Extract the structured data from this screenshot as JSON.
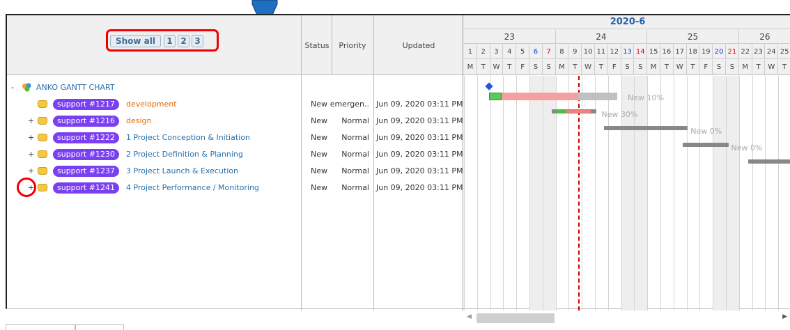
{
  "pager": {
    "show_all": "Show all",
    "pages": [
      "1",
      "2",
      "3"
    ]
  },
  "columns": {
    "status": "Status",
    "priority": "Priority",
    "updated": "Updated"
  },
  "timeline": {
    "month": "2020-6",
    "weeks": [
      "23",
      "24",
      "25",
      "26"
    ],
    "days": [
      "1",
      "2",
      "3",
      "4",
      "5",
      "6",
      "7",
      "8",
      "9",
      "10",
      "11",
      "12",
      "13",
      "14",
      "15",
      "16",
      "17",
      "18",
      "19",
      "20",
      "21",
      "22",
      "23",
      "24",
      "25"
    ],
    "weekdays": [
      "M",
      "T",
      "W",
      "T",
      "F",
      "S",
      "S",
      "M",
      "T",
      "W",
      "T",
      "F",
      "S",
      "S",
      "M",
      "T",
      "W",
      "T",
      "F",
      "S",
      "S",
      "M",
      "T",
      "W",
      "T"
    ]
  },
  "root": {
    "toggle": "-",
    "title": "ANKO GANTT CHART"
  },
  "rows": [
    {
      "toggle": "",
      "badge": "support #1217",
      "title": "development",
      "orange": true,
      "status": "New",
      "priority": "emergen..",
      "updated": "Jun 09, 2020 03:11 PM",
      "bar_label": "New 10%"
    },
    {
      "toggle": "+",
      "badge": "support #1216",
      "title": "design",
      "orange": true,
      "status": "New",
      "priority": "Normal",
      "updated": "Jun 09, 2020 03:11 PM",
      "bar_label": "New 30%"
    },
    {
      "toggle": "+",
      "badge": "support #1222",
      "title": "1 Project Conception & Initiation",
      "orange": false,
      "status": "New",
      "priority": "Normal",
      "updated": "Jun 09, 2020 03:11 PM",
      "bar_label": "New 0%"
    },
    {
      "toggle": "+",
      "badge": "support #1230",
      "title": "2 Project Definition & Planning",
      "orange": false,
      "status": "New",
      "priority": "Normal",
      "updated": "Jun 09, 2020 03:11 PM",
      "bar_label": "New 0%"
    },
    {
      "toggle": "+",
      "badge": "support #1237",
      "title": "3 Project Launch & Execution",
      "orange": false,
      "status": "New",
      "priority": "Normal",
      "updated": "Jun 09, 2020 03:11 PM",
      "bar_label": ""
    },
    {
      "toggle": "+",
      "badge": "support #1241",
      "title": "4 Project Performance / Monitoring",
      "orange": false,
      "status": "New",
      "priority": "Normal",
      "updated": "Jun 09, 2020 03:11 PM",
      "bar_label": ""
    }
  ],
  "colors": {
    "accent": "#7b3ff2",
    "highlight": "#e00000",
    "today": "#d00000"
  }
}
